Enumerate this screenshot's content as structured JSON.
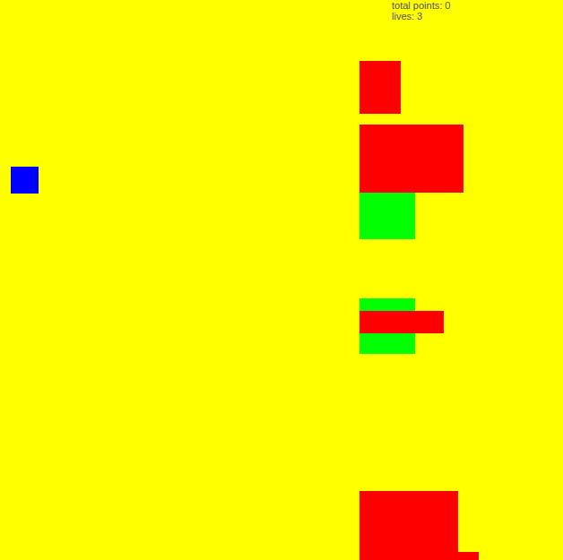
{
  "hud": {
    "points": "total points: 0",
    "lives": "lives: 3"
  },
  "player": {
    "color": "#0000ff"
  },
  "objects": [
    {
      "kind": "obstacle",
      "color": "#ff0000"
    },
    {
      "kind": "obstacle",
      "color": "#ff0000"
    },
    {
      "kind": "bonus",
      "color": "#00ff00"
    },
    {
      "kind": "bonus",
      "color": "#00ff00"
    },
    {
      "kind": "obstacle",
      "color": "#ff0000"
    },
    {
      "kind": "obstacle",
      "color": "#ff0000"
    },
    {
      "kind": "obstacle",
      "color": "#ff0000"
    }
  ]
}
